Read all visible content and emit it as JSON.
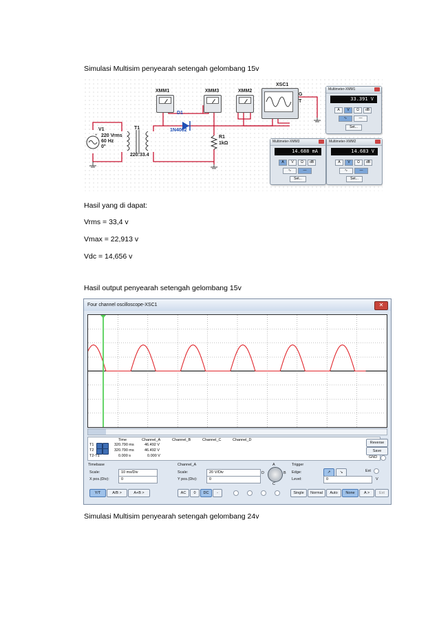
{
  "document": {
    "heading_15v": "Simulasi Multisim penyearah setengah gelombang 15v",
    "results_heading": "Hasil yang di dapat:",
    "vrms": "Vrms = 33,4  v",
    "vmax": "Vmax = 22,913 v",
    "vdc": "Vdc = 14,656 v",
    "output_heading": "Hasil output penyearah setengah gelombang 15v",
    "heading_24v": "Simulasi Multisim penyearah setengah gelombang 24v"
  },
  "schematic": {
    "source": {
      "name": "V1",
      "voltage": "220 Vrms",
      "frequency": "60 Hz",
      "phase": "0°"
    },
    "transformer": {
      "name": "T1",
      "ratio": "220:33.4"
    },
    "diode": {
      "name": "D1",
      "part": "1N4002"
    },
    "resistor": {
      "name": "R1",
      "value": "1kΩ"
    },
    "meters": [
      "XMM1",
      "XMM3",
      "XMM2"
    ],
    "scope": {
      "name": "XSC1",
      "terminals": [
        "G",
        "T"
      ]
    },
    "multimeter_windows": [
      {
        "title": "Multimeter-XMM1",
        "reading": "33.391 V",
        "set_label": "Set..."
      },
      {
        "title": "Multimeter-XMM3",
        "reading": "14.688 mA",
        "set_label": "Set..."
      },
      {
        "title": "Multimeter-XMM2",
        "reading": "14.683 V",
        "set_label": "Set..."
      }
    ],
    "multimeter_buttons": [
      "A",
      "V",
      "Ω",
      "dB"
    ],
    "colors": {
      "wire": "#c8102e",
      "diode": "#1f4fb4",
      "ground": "#444444"
    }
  },
  "oscilloscope": {
    "window_title": "Four channel oscilloscope-XSC1",
    "close_label": "✕",
    "readout_headers": [
      "Time",
      "Channel_A",
      "Channel_B",
      "Channel_C",
      "Channel_D"
    ],
    "rows": [
      {
        "label": "T1",
        "time": "320.790 ms",
        "channel_a": "46.492 V"
      },
      {
        "label": "T2",
        "time": "320.790 ms",
        "channel_a": "46.492 V"
      },
      {
        "label": "T2-T1",
        "time": "0.000 s",
        "channel_a": "0.000 V"
      }
    ],
    "side_buttons": {
      "reverse": "Reverse",
      "save": "Save",
      "gnd": "GND"
    },
    "timebase": {
      "title": "Timebase",
      "scale_label": "Scale:",
      "scale": "10 ms/Div",
      "xpos_label": "X pos.(Div):",
      "xpos": "0"
    },
    "channel": {
      "title": "Channel_A",
      "scale_label": "Scale:",
      "scale": "20  V/Div",
      "ypos_label": "Y pos.(Div):",
      "ypos": "0"
    },
    "trigger": {
      "title": "Trigger",
      "edge_label": "Edge:",
      "level_label": "Level:",
      "level": "0",
      "level_unit": "V",
      "ext_label": "Ext"
    },
    "knob_labels": [
      "A",
      "B",
      "C",
      "D"
    ],
    "mode_buttons": [
      "Y/T",
      "A/B >",
      "A+B >"
    ],
    "coupling_buttons": [
      "AC",
      "0",
      "DC",
      "-"
    ],
    "trigger_buttons": [
      "Single",
      "Normal",
      "Auto",
      "None",
      "A >",
      "Ext"
    ],
    "selected": {
      "mode": "Y/T",
      "coupling": "DC",
      "trigger": "None"
    },
    "colors": {
      "trace": "#e0242a",
      "cursor": "#58d15a",
      "grid": "#8a8a8a",
      "axis": "#000000"
    }
  },
  "chart_data": {
    "type": "line",
    "title": "",
    "xlabel": "",
    "ylabel": "",
    "x_unit": "ms",
    "y_unit": "V",
    "xlim": [
      0,
      100
    ],
    "ylim": [
      -100,
      100
    ],
    "series": [
      {
        "name": "Channel_A",
        "description": "half-wave rectified sine, 60 Hz, peak ~46.5 V",
        "period_ms": 16.67,
        "peak_v": 46.492,
        "phase_ms": 1.8,
        "t_start_ms": -2.5,
        "t_end_ms": 93.0
      }
    ],
    "cursors": [
      {
        "name": "T1",
        "x_ms": 0
      },
      {
        "name": "T2",
        "x_ms": 0
      }
    ],
    "grid": true
  }
}
